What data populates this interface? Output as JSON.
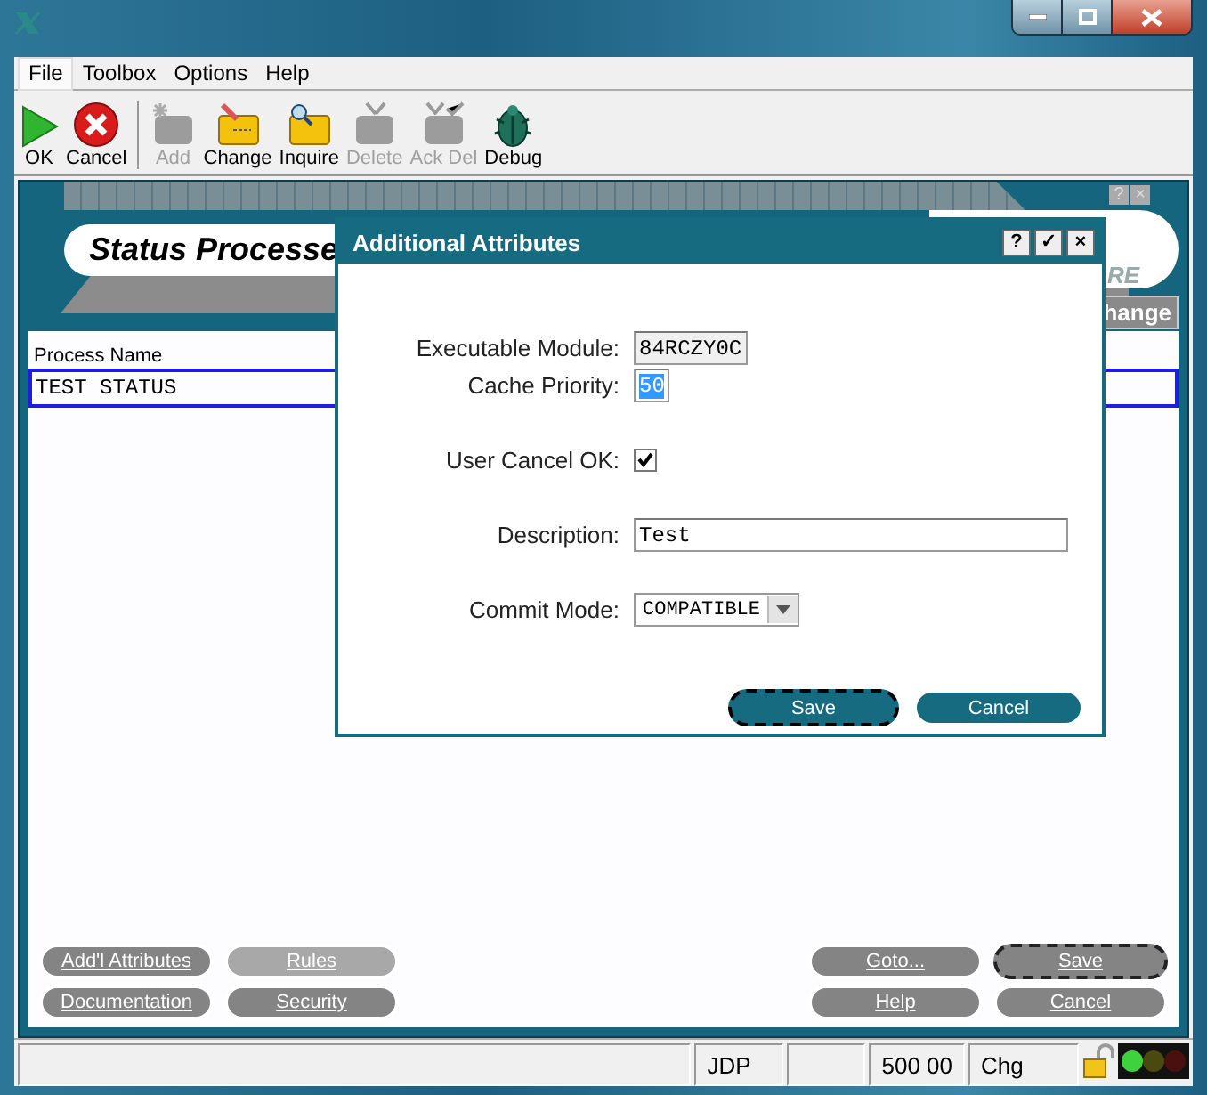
{
  "menu": [
    {
      "label": "File",
      "selected": true
    },
    {
      "label": "Toolbox",
      "selected": false
    },
    {
      "label": "Options",
      "selected": false
    },
    {
      "label": "Help",
      "selected": false
    }
  ],
  "toolbar": [
    {
      "label": "OK",
      "disabled": false
    },
    {
      "label": "Cancel",
      "disabled": false
    },
    {
      "label": "Add",
      "disabled": true
    },
    {
      "label": "Change",
      "disabled": false
    },
    {
      "label": "Inquire",
      "disabled": false
    },
    {
      "label": "Delete",
      "disabled": true
    },
    {
      "label": "Ack Del",
      "disabled": true
    },
    {
      "label": "Debug",
      "disabled": false
    }
  ],
  "form": {
    "title": "Status Processe",
    "frame_buttons": [
      "?",
      "×"
    ],
    "logo_text": "RE",
    "partial_button": "hange",
    "column": "Process Name",
    "rows": [
      {
        "process_name": "TEST STATUS",
        "selected": true
      }
    ],
    "left_buttons": [
      {
        "label": "Add'l Attributes",
        "disabled": false,
        "focused": false
      },
      {
        "label": "Rules",
        "disabled": true,
        "focused": false
      },
      {
        "label": "Documentation",
        "disabled": false,
        "focused": false
      },
      {
        "label": "Security",
        "disabled": false,
        "focused": false
      }
    ],
    "right_buttons": [
      {
        "label": "Goto...",
        "disabled": false,
        "focused": false
      },
      {
        "label": "Save",
        "disabled": false,
        "focused": true
      },
      {
        "label": "Help",
        "disabled": false,
        "focused": false
      },
      {
        "label": "Cancel",
        "disabled": false,
        "focused": false
      }
    ]
  },
  "dialog": {
    "title": "Additional Attributes",
    "title_buttons": [
      "?",
      "✓",
      "×"
    ],
    "fields": [
      {
        "kind": "text",
        "label": "Executable Module:",
        "value": "84RCZY0C",
        "readonly": true,
        "highlighted": false
      },
      {
        "kind": "text",
        "label": "Cache Priority:",
        "value": "50",
        "readonly": false,
        "highlighted": true
      },
      {
        "kind": "checkbox",
        "label": "User Cancel OK:",
        "checked": true
      },
      {
        "kind": "wide",
        "label": "Description:",
        "value": "Test",
        "readonly": false,
        "highlighted": false
      },
      {
        "kind": "select",
        "label": "Commit Mode:",
        "value": "COMPATIBLE"
      }
    ],
    "buttons": [
      {
        "label": "Save",
        "focused": true
      },
      {
        "label": "Cancel",
        "focused": false
      }
    ]
  },
  "status_bar": {
    "cells": [
      "JDP",
      "500 00",
      "Chg"
    ]
  }
}
